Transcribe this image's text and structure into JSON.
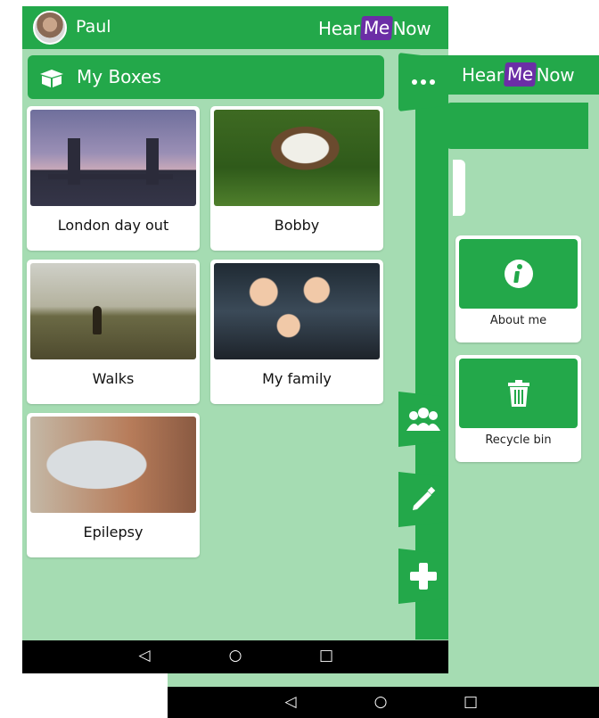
{
  "front": {
    "user_name": "Paul",
    "logo": {
      "part1": "Hear",
      "part2": "Me",
      "part3": "Now"
    },
    "section_title": "My Boxes",
    "boxes": [
      {
        "caption": "London day out"
      },
      {
        "caption": "Bobby"
      },
      {
        "caption": "Walks"
      },
      {
        "caption": "My family"
      },
      {
        "caption": "Epilepsy"
      }
    ],
    "navbar": {
      "back": "◁",
      "home": "○",
      "recent": "□"
    }
  },
  "back": {
    "logo": {
      "part1": "Hear",
      "part2": "Me",
      "part3": "Now"
    },
    "cards": [
      {
        "label": "About me",
        "icon": "info-icon"
      },
      {
        "label": "Recycle bin",
        "icon": "trash-icon"
      }
    ],
    "navbar": {
      "back": "◁",
      "home": "○",
      "recent": "□"
    }
  },
  "colors": {
    "green": "#23a84a",
    "light_green": "#a5dcb2",
    "purple": "#6b2ea6"
  },
  "icons": [
    "box-icon",
    "more-icon",
    "group-icon",
    "pencil-icon",
    "plus-icon",
    "avatar"
  ]
}
